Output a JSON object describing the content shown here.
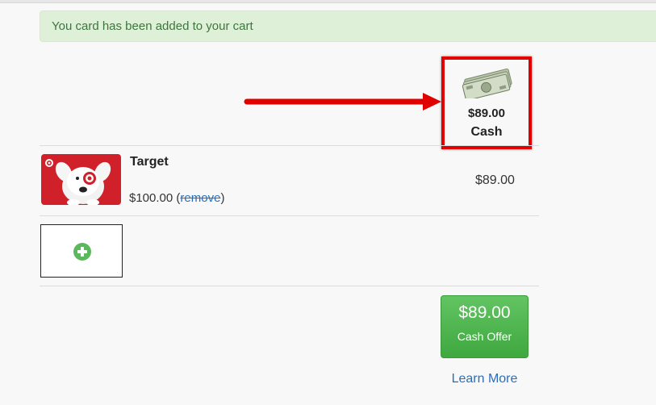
{
  "alert": {
    "message": "You card has been added to your cart"
  },
  "cash_summary": {
    "amount": "$89.00",
    "label": "Cash",
    "icon": "money-stack-icon"
  },
  "cart": {
    "items": [
      {
        "name": "Target",
        "value": "$100.00",
        "remove_prefix": "(",
        "remove_label": "remove",
        "remove_suffix": ")",
        "offer": "$89.00",
        "image_icon": "target-gift-card-image"
      }
    ],
    "add_card_icon": "plus-circle-icon"
  },
  "offer_button": {
    "amount": "$89.00",
    "label": "Cash Offer"
  },
  "learn_more": "Learn More",
  "colors": {
    "alert_background": "#dff0d8",
    "alert_text": "#3c763d",
    "highlight_border": "#e00000",
    "button_green": "#4cae4c",
    "link_blue": "#2a6ebb"
  }
}
